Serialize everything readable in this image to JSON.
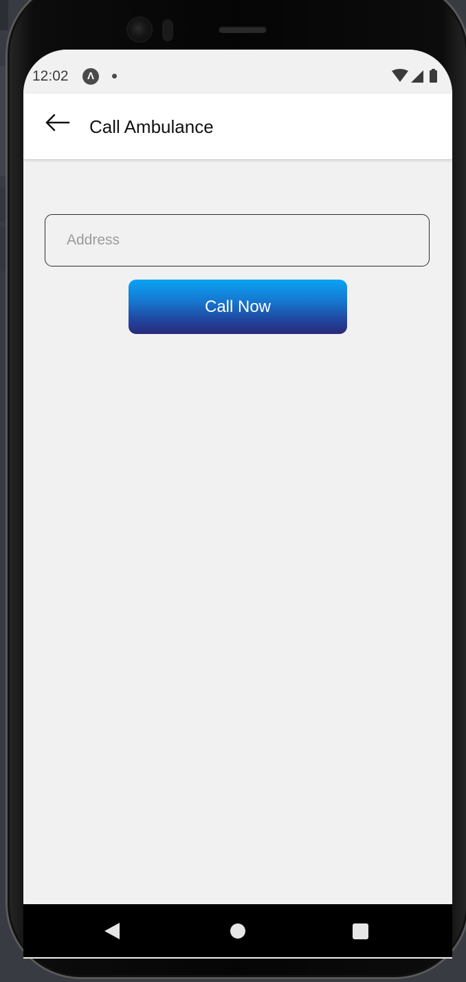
{
  "status_bar": {
    "time": "12:02",
    "app_icon_glyph": "Λ"
  },
  "header": {
    "title": "Call Ambulance",
    "back_icon": "arrow-left-icon"
  },
  "form": {
    "address_placeholder": "Address",
    "address_value": "",
    "call_button_label": "Call Now"
  },
  "colors": {
    "button_gradient_top": "#0aa3f4",
    "button_gradient_bottom": "#292a78",
    "screen_background": "#f1f1f1",
    "header_background": "#ffffff"
  }
}
